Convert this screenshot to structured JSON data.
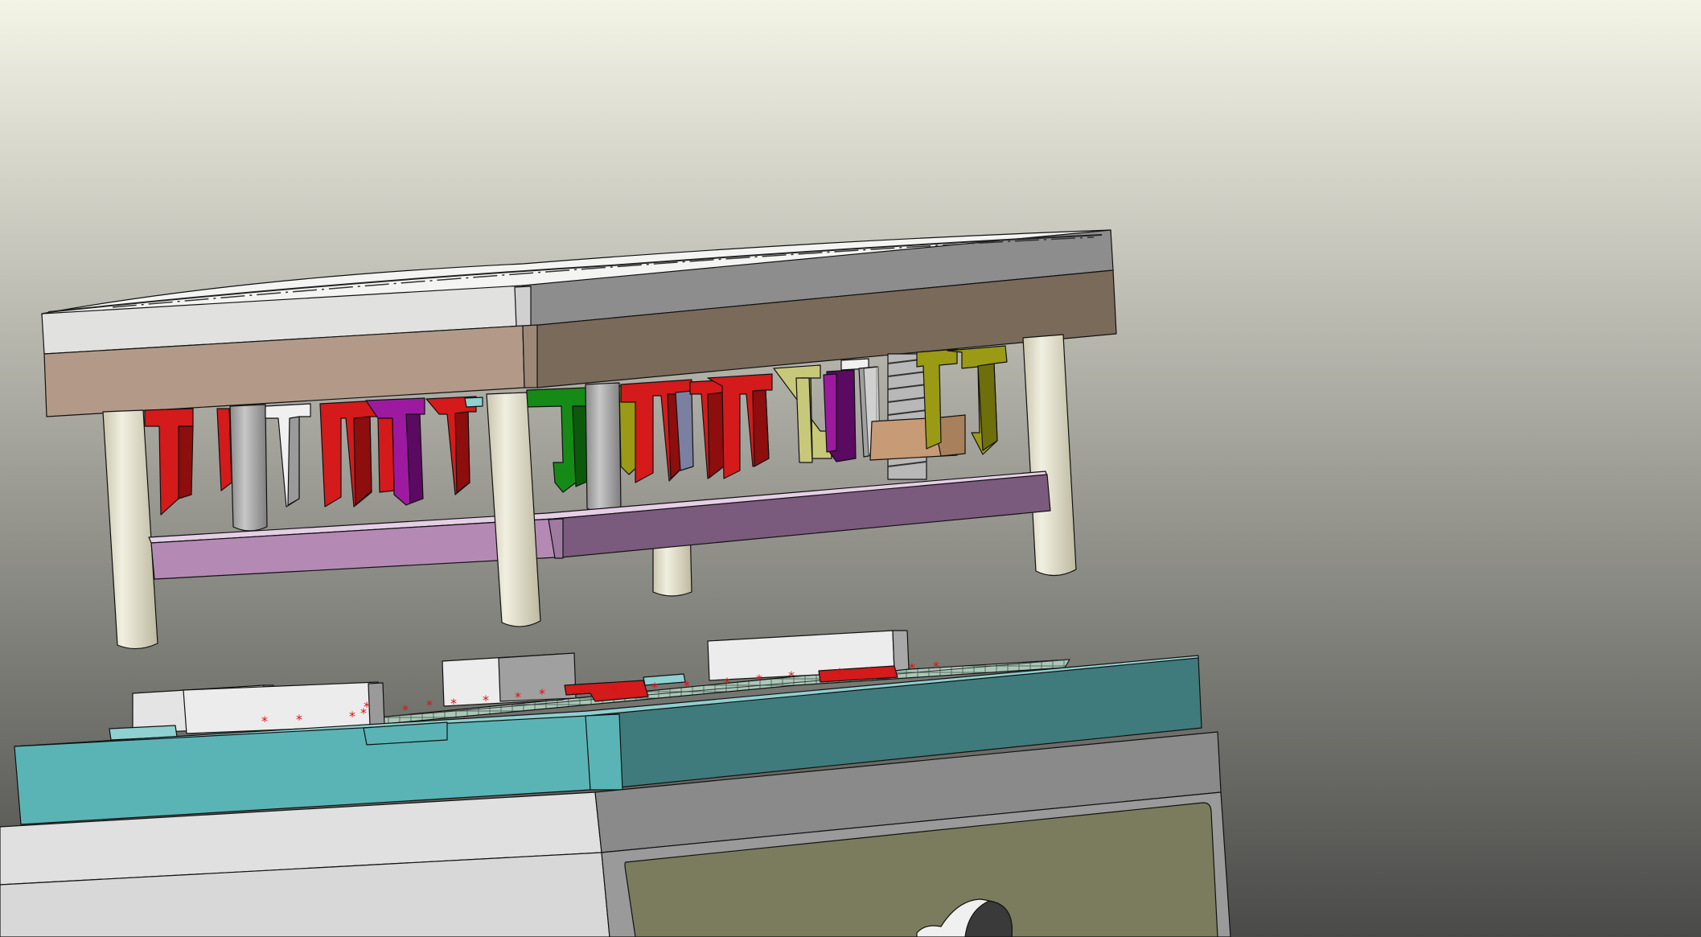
{
  "viewport": {
    "background_top": "#f3f3e6",
    "background_bottom": "#4a4a48"
  },
  "colors": {
    "plate_light": "#e1e1df",
    "plate_gray": "#8d8d8d",
    "plate_gray_dark": "#7a7a7a",
    "plate_tan_light": "#b39a88",
    "plate_tan_dark": "#7a6a5a",
    "stripper_light": "#b48ab5",
    "stripper_dark": "#7a5a7d",
    "guide_pin": "#e6e3cf",
    "guide_pin_shade": "#c9c5ad",
    "punch_red": "#d41a1a",
    "punch_red_dark": "#8e0d0d",
    "punch_magenta": "#9d1aa0",
    "punch_purple": "#5a0a60",
    "punch_green": "#168a16",
    "punch_green_dark": "#0b5a0b",
    "punch_olive": "#9a9a14",
    "punch_olive_light": "#c8c87a",
    "punch_white": "#eeeeee",
    "punch_gray": "#a0a0a0",
    "spring": "#b8b8b8",
    "block_brown": "#c79b75",
    "die_plate_light": "#5ab4b6",
    "die_plate_dark": "#3f7b7c",
    "die_set_light": "#e0e0e0",
    "die_set_gray": "#8a8a8a",
    "die_set_olive": "#7b7b5e",
    "strip_dots": "#e01010",
    "edge_line": "#111111"
  },
  "icons": {
    "part_markers": "asterisk-icon"
  }
}
